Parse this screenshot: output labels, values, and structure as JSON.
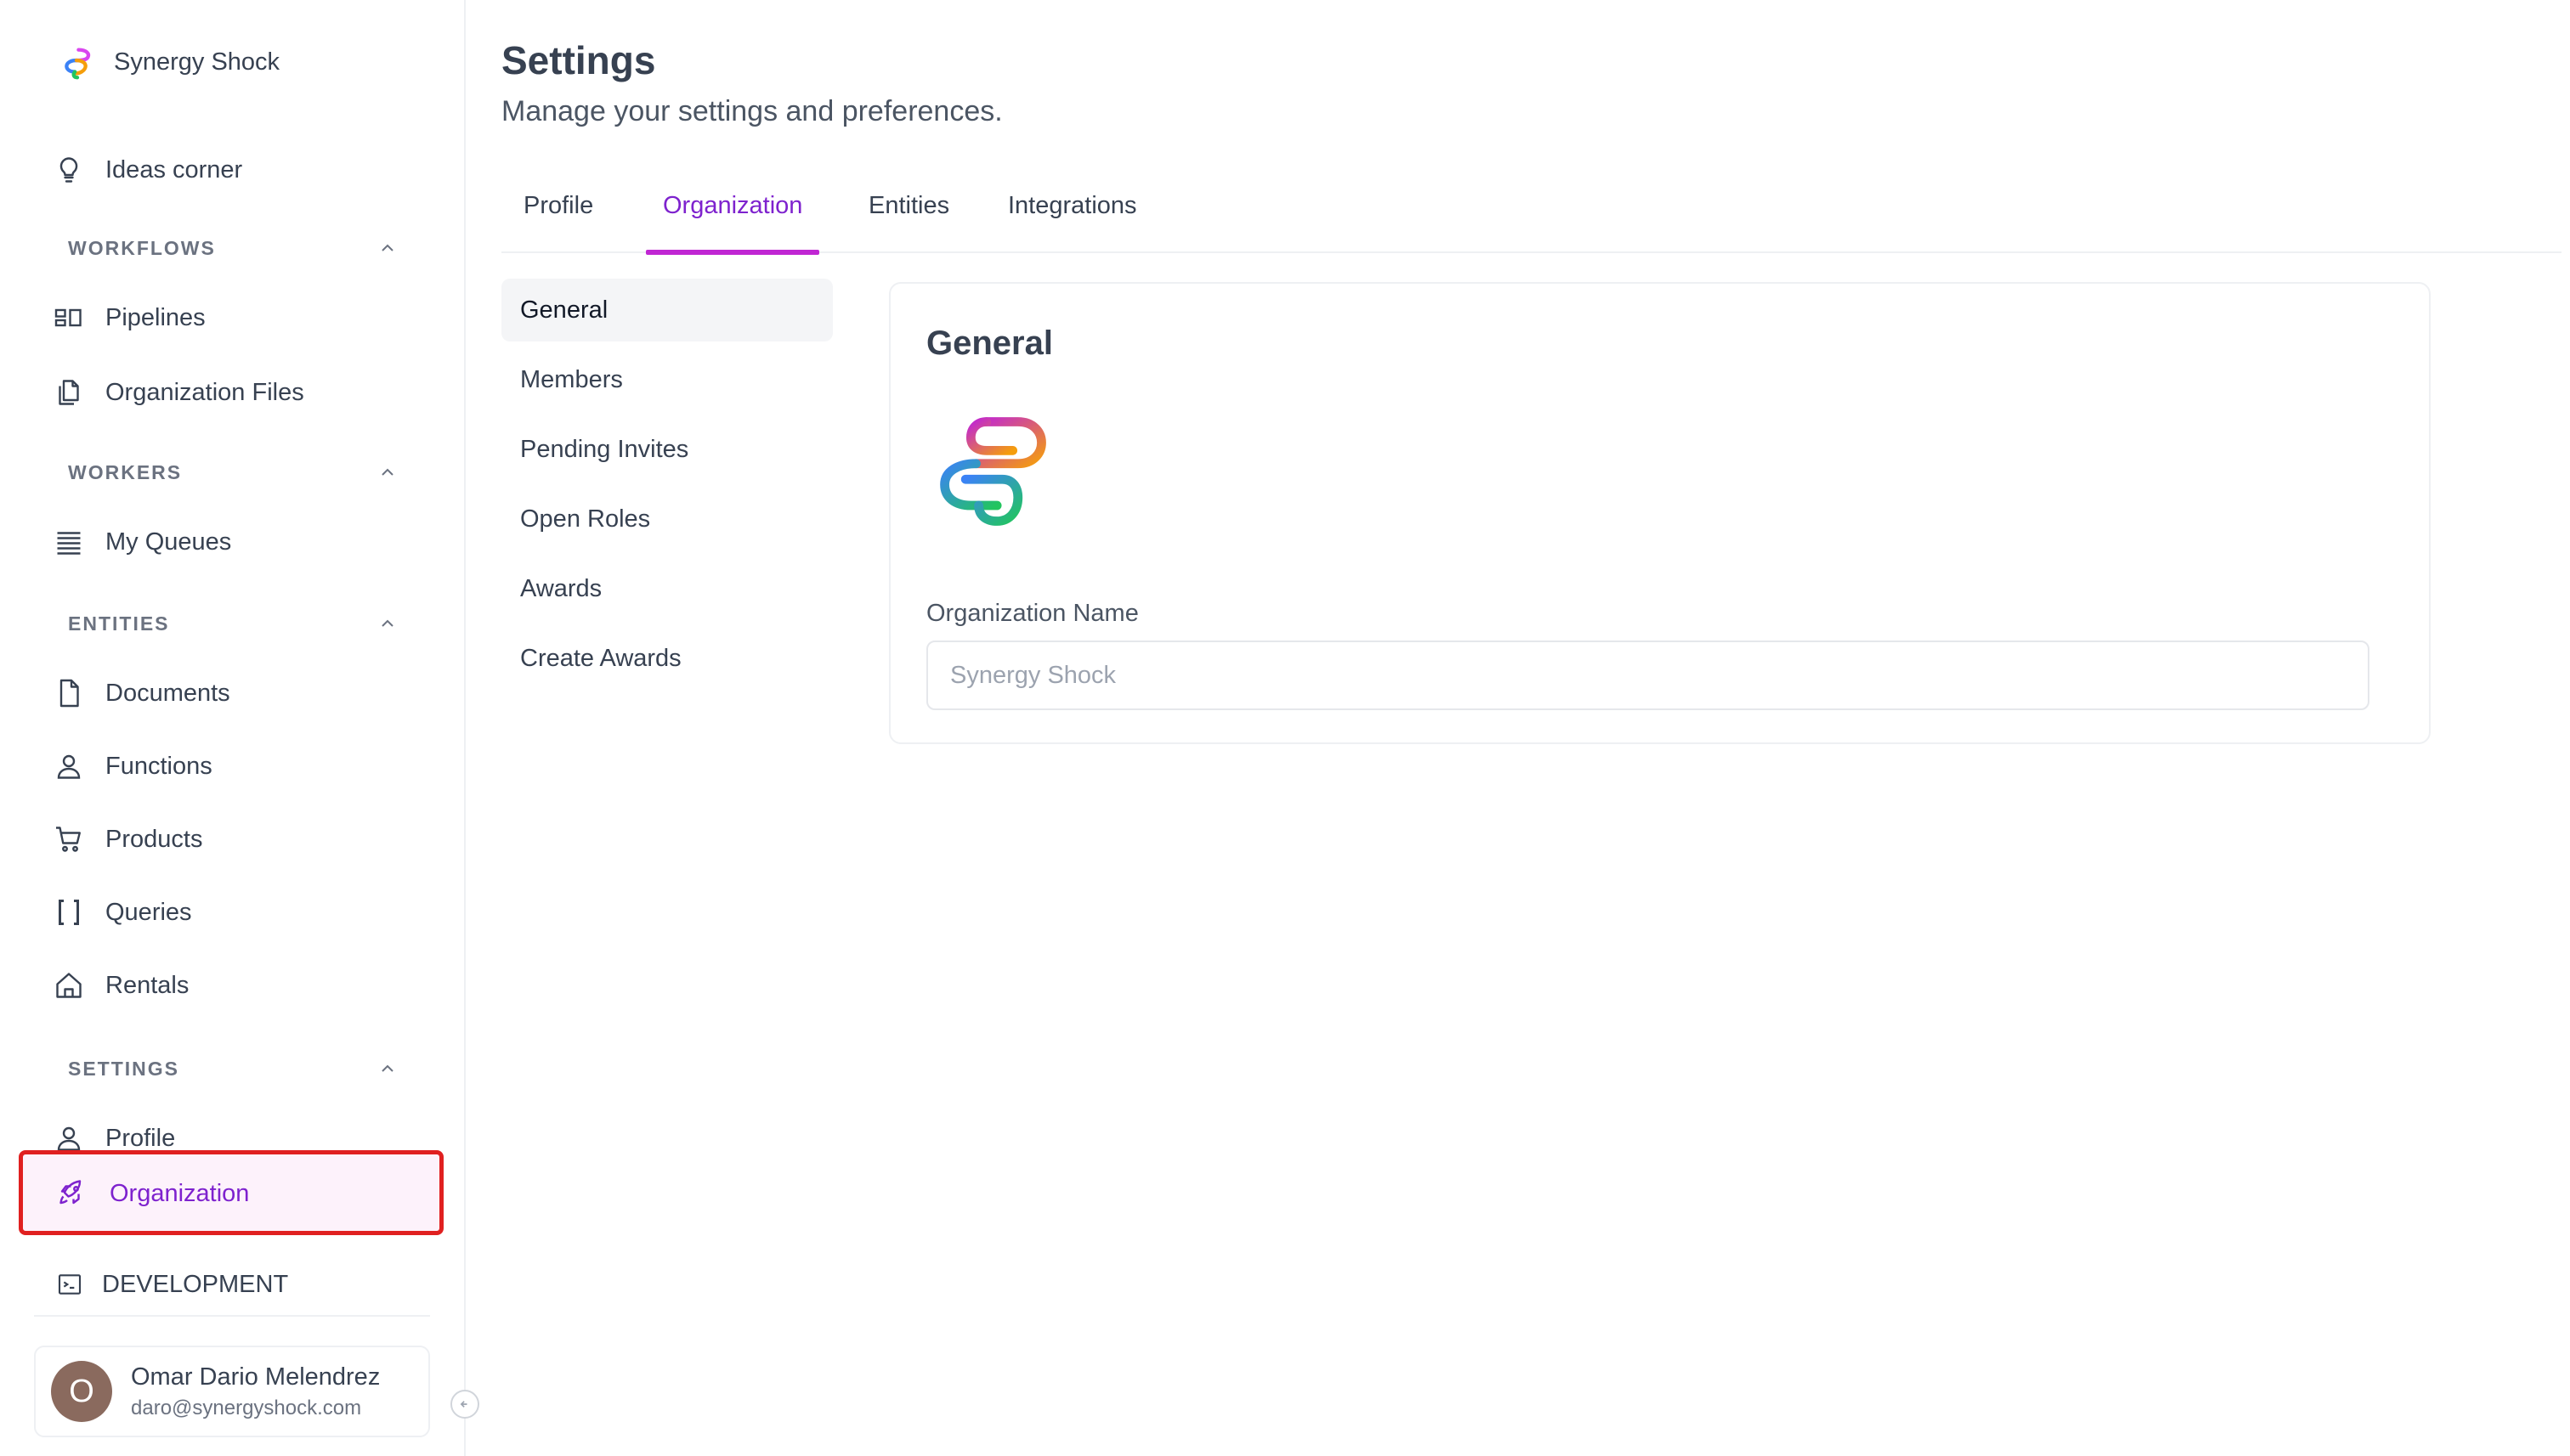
{
  "brand": {
    "name": "Synergy Shock"
  },
  "sidebar": {
    "ideas": {
      "label": "Ideas corner"
    },
    "sections": [
      {
        "title": "WORKFLOWS"
      },
      {
        "title": "WORKERS"
      },
      {
        "title": "ENTITIES"
      },
      {
        "title": "SETTINGS"
      }
    ],
    "workflows": [
      {
        "label": "Pipelines",
        "icon": "pipelines-icon"
      },
      {
        "label": "Organization Files",
        "icon": "files-icon"
      }
    ],
    "workers": [
      {
        "label": "My Queues",
        "icon": "queues-icon"
      }
    ],
    "entities": [
      {
        "label": "Documents",
        "icon": "document-icon"
      },
      {
        "label": "Functions",
        "icon": "user-icon"
      },
      {
        "label": "Products",
        "icon": "cart-icon"
      },
      {
        "label": "Queries",
        "icon": "brackets-icon"
      },
      {
        "label": "Rentals",
        "icon": "home-icon"
      }
    ],
    "settings": [
      {
        "label": "Profile",
        "icon": "user-icon"
      },
      {
        "label": "Organization",
        "icon": "rocket-icon"
      }
    ],
    "development": {
      "label": "DEVELOPMENT"
    }
  },
  "user": {
    "initial": "O",
    "name": "Omar Dario Melendrez",
    "email": "daro@synergyshock.com"
  },
  "page": {
    "title": "Settings",
    "subtitle": "Manage your settings and preferences."
  },
  "tabs": [
    {
      "label": "Profile"
    },
    {
      "label": "Organization",
      "active": true
    },
    {
      "label": "Entities"
    },
    {
      "label": "Integrations"
    }
  ],
  "subnav": [
    {
      "label": "General",
      "active": true
    },
    {
      "label": "Members"
    },
    {
      "label": "Pending Invites"
    },
    {
      "label": "Open Roles"
    },
    {
      "label": "Awards"
    },
    {
      "label": "Create Awards"
    }
  ],
  "general": {
    "title": "General",
    "org_name_label": "Organization Name",
    "org_name_placeholder": "Synergy Shock",
    "org_name_value": ""
  },
  "colors": {
    "accent": "#7e22ce",
    "tab_underline": "#c026d3",
    "highlight_border": "#e02020",
    "active_bg": "#fdf2fb"
  }
}
